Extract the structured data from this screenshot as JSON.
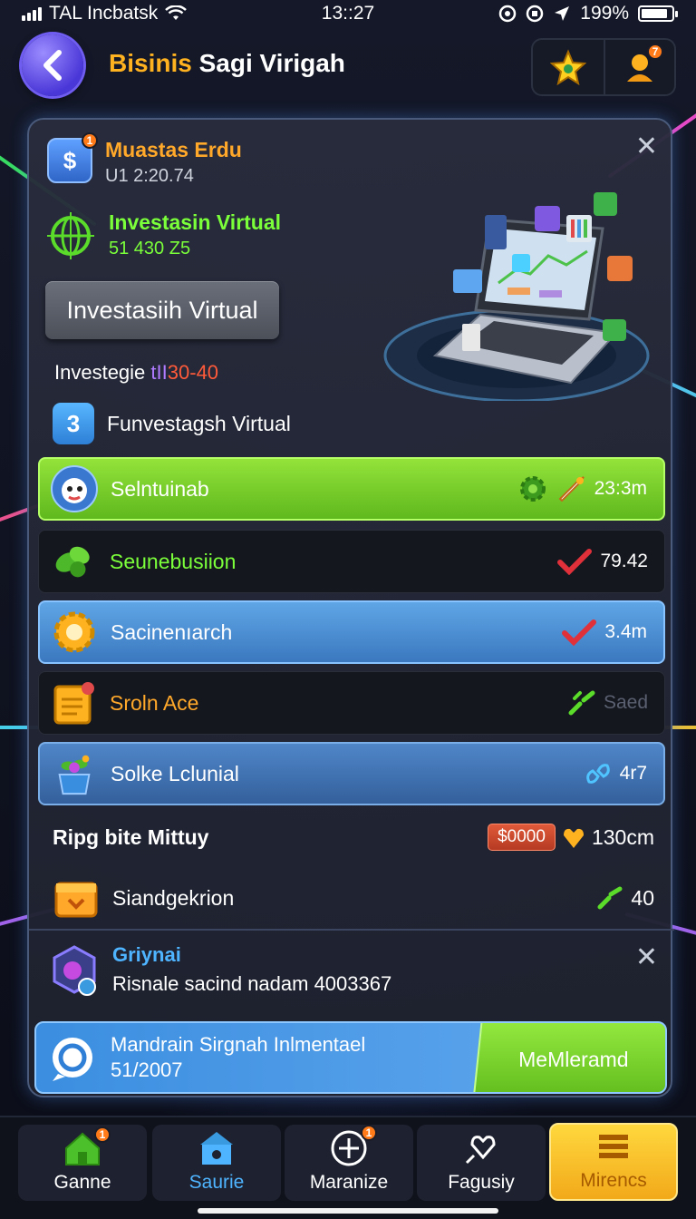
{
  "status_bar": {
    "carrier": "TAL Incbatsk",
    "time": "13::27",
    "battery": "199%"
  },
  "header": {
    "title_accent": "Bisinis",
    "title_rest": "Sagi Virigah",
    "badge_count": "7"
  },
  "panel": {
    "item1": {
      "title": "Muastas Erdu",
      "sub": "U1 2:20.74",
      "badge": "1"
    },
    "item2": {
      "title": "Investasin Virtual",
      "sub": "51 430 Z5"
    },
    "primary_button": "Investasiih Virtual",
    "invest_line": {
      "prefix": "Investegie",
      "mid": "tII",
      "value": "30-40"
    },
    "fv_label": "Funvestagsh Virtual",
    "fv_icon": "3"
  },
  "rows": [
    {
      "name": "Selntuinab",
      "value": "23:3m",
      "style": "green"
    },
    {
      "name": "Seunebusiion",
      "value": "79.42",
      "style": "dark"
    },
    {
      "name": "Sacinenıarch",
      "value": "3.4m",
      "style": "blue"
    },
    {
      "name": "Sroln Ace",
      "value": "Saed",
      "style": "dark"
    },
    {
      "name": "Solke Lclunial",
      "value": "4r7",
      "style": "blue2"
    }
  ],
  "summary": {
    "label": "Ripg bite Mittuy",
    "price": "$0000",
    "amount": "130cm"
  },
  "extra_row": {
    "name": "Siandgekrion",
    "value": "40"
  },
  "notice": {
    "title": "Griynai",
    "text": "Risnale sacind nadam 4003367"
  },
  "promo": {
    "line1": "Mandrain Sirgnah Inlmentael",
    "line2": "51/2007",
    "button": "MeMleramd"
  },
  "nav": [
    {
      "label": "Ganne",
      "badge": "1"
    },
    {
      "label": "Saurie"
    },
    {
      "label": "Maranize",
      "badge": "1"
    },
    {
      "label": "Fagusiy"
    },
    {
      "label": "Mirencs"
    }
  ]
}
